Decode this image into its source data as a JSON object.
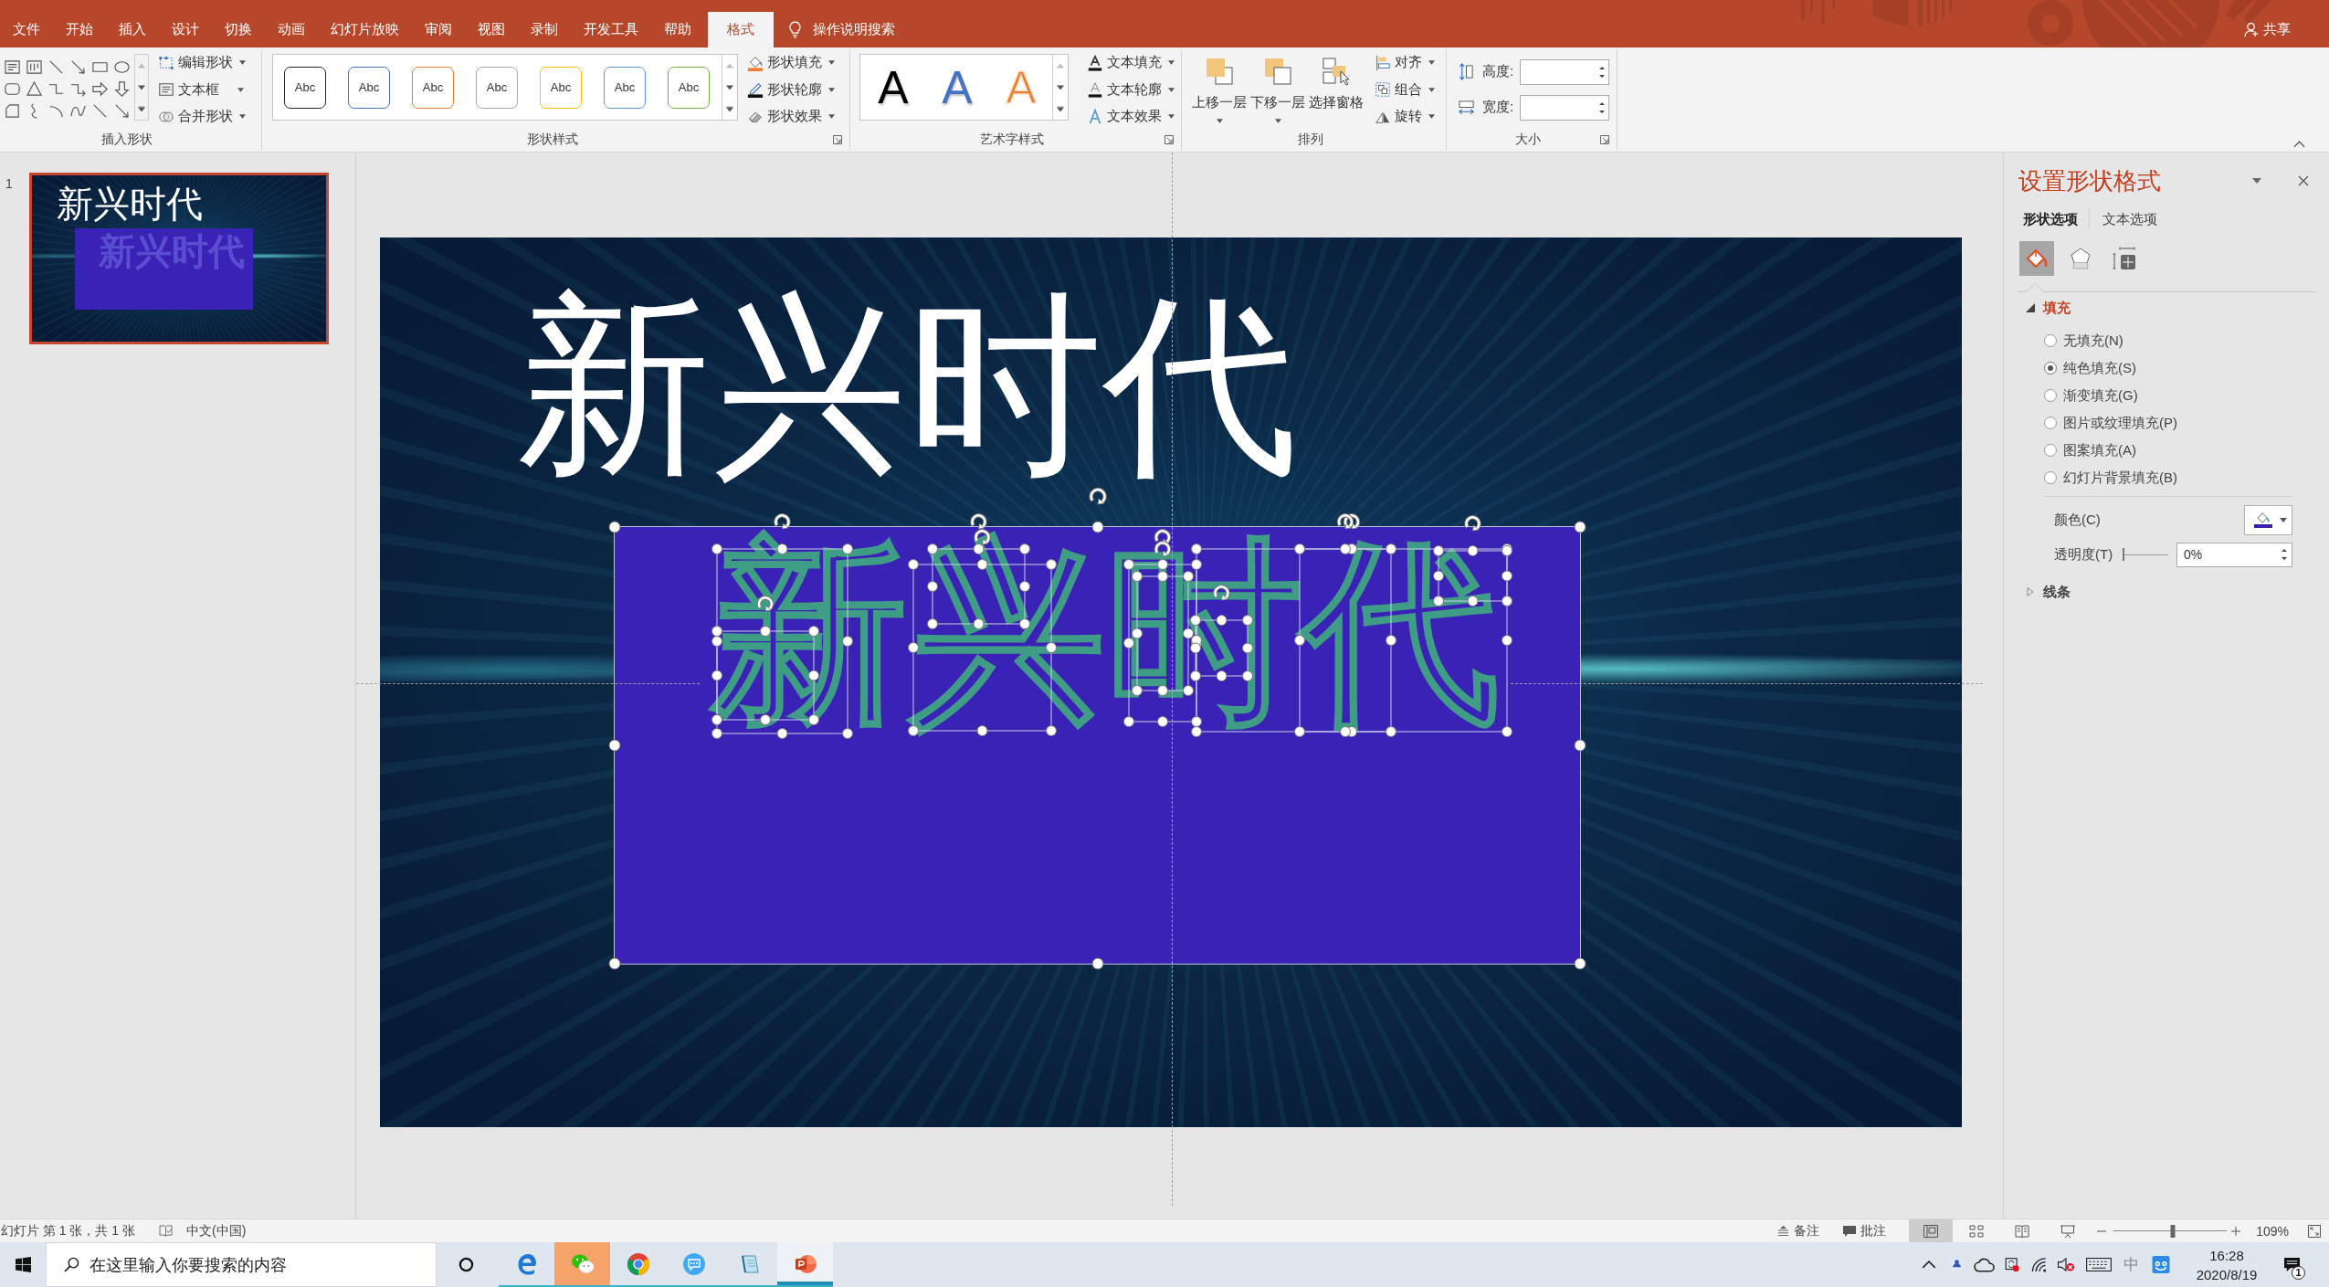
{
  "title_bar": {
    "share": "共享"
  },
  "tabs": [
    {
      "label": "文件",
      "selected": false
    },
    {
      "label": "开始",
      "selected": false
    },
    {
      "label": "插入",
      "selected": false
    },
    {
      "label": "设计",
      "selected": false
    },
    {
      "label": "切换",
      "selected": false
    },
    {
      "label": "动画",
      "selected": false
    },
    {
      "label": "幻灯片放映",
      "selected": false
    },
    {
      "label": "审阅",
      "selected": false
    },
    {
      "label": "视图",
      "selected": false
    },
    {
      "label": "录制",
      "selected": false
    },
    {
      "label": "开发工具",
      "selected": false
    },
    {
      "label": "帮助",
      "selected": false
    },
    {
      "label": "格式",
      "selected": true
    }
  ],
  "tell_me": {
    "placeholder": "操作说明搜索"
  },
  "ribbon": {
    "insert_shapes": {
      "label": "插入形状",
      "commands": [
        "编辑形状",
        "文本框",
        "合并形状"
      ]
    },
    "shape_styles": {
      "label": "形状样式",
      "presets": [
        {
          "text": "Abc",
          "color": "#262626"
        },
        {
          "text": "Abc",
          "color": "#4472c4"
        },
        {
          "text": "Abc",
          "color": "#ed7d31"
        },
        {
          "text": "Abc",
          "color": "#a5a5a5"
        },
        {
          "text": "Abc",
          "color": "#ffc000"
        },
        {
          "text": "Abc",
          "color": "#5b9bd5"
        },
        {
          "text": "Abc",
          "color": "#70ad47"
        }
      ],
      "commands": [
        "形状填充",
        "形状轮廓",
        "形状效果"
      ]
    },
    "wordart_styles": {
      "label": "艺术字样式",
      "presets": [
        {
          "text": "A",
          "kind": "solid",
          "color": "#000000"
        },
        {
          "text": "A",
          "kind": "solid",
          "color": "#4472c4"
        },
        {
          "text": "A",
          "kind": "outline",
          "color": "#ed7d31"
        }
      ],
      "commands": [
        "文本填充",
        "文本轮廓",
        "文本效果"
      ]
    },
    "arrange": {
      "label": "排列",
      "large_buttons": [
        "上移一层",
        "下移一层",
        "选择窗格"
      ],
      "commands": [
        "对齐",
        "组合",
        "旋转"
      ]
    },
    "size": {
      "label": "大小",
      "fields": [
        {
          "label": "高度:"
        },
        {
          "label": "宽度:"
        }
      ]
    }
  },
  "thumbnails": [
    {
      "number": "1",
      "selected": true,
      "title": "新兴时代",
      "box_text": "新兴时代"
    }
  ],
  "slide": {
    "title": "新兴时代",
    "box_text": "新兴时代",
    "box_selected": true
  },
  "format_pane": {
    "title": "设置形状格式",
    "tabs": [
      {
        "label": "形状选项",
        "selected": true
      },
      {
        "label": "文本选项",
        "selected": false
      }
    ],
    "icon_tabs": [
      {
        "kind": "fill_line",
        "selected": true
      },
      {
        "kind": "effects",
        "selected": false
      },
      {
        "kind": "size_properties",
        "selected": false
      }
    ],
    "sections": [
      {
        "label": "填充",
        "expanded": true,
        "options": [
          {
            "label": "无填充(N)",
            "selected": false
          },
          {
            "label": "纯色填充(S)",
            "selected": true
          },
          {
            "label": "渐变填充(G)",
            "selected": false
          },
          {
            "label": "图片或纹理填充(P)",
            "selected": false
          },
          {
            "label": "图案填充(A)",
            "selected": false
          },
          {
            "label": "幻灯片背景填充(B)",
            "selected": false
          }
        ],
        "color": {
          "label": "颜色(C)",
          "color": "#3b22b6"
        },
        "transparency": {
          "label": "透明度(T)",
          "level": 0,
          "value": "0%"
        }
      },
      {
        "label": "线条",
        "expanded": false
      }
    ]
  },
  "status_bar": {
    "slide_info": "幻灯片 第 1 张，共 1 张",
    "language": "中文(中国)",
    "notes": "备注",
    "comments": "批注",
    "views": [
      {
        "kind": "normal",
        "selected": true
      },
      {
        "kind": "sorter",
        "selected": false
      },
      {
        "kind": "reading",
        "selected": false
      },
      {
        "kind": "slideshow",
        "selected": false
      }
    ],
    "zoom": {
      "level": 0.52,
      "value": "109%"
    }
  },
  "taskbar": {
    "search": {
      "placeholder": "在这里输入你要搜索的内容"
    },
    "apps": [
      {
        "kind": "edge",
        "running": true,
        "selected": false,
        "flashing": false
      },
      {
        "kind": "wechat",
        "running": true,
        "selected": false,
        "flashing": true
      },
      {
        "kind": "chrome",
        "running": true,
        "selected": false,
        "flashing": false
      },
      {
        "kind": "messenger",
        "running": true,
        "selected": false,
        "flashing": false
      },
      {
        "kind": "notepad",
        "running": true,
        "selected": false,
        "flashing": false
      },
      {
        "kind": "powerpoint",
        "running": true,
        "selected": true,
        "flashing": false
      }
    ],
    "tray": {
      "ime": "中",
      "time": "16:28",
      "date": "2020/8/19",
      "notifications": "1"
    }
  }
}
